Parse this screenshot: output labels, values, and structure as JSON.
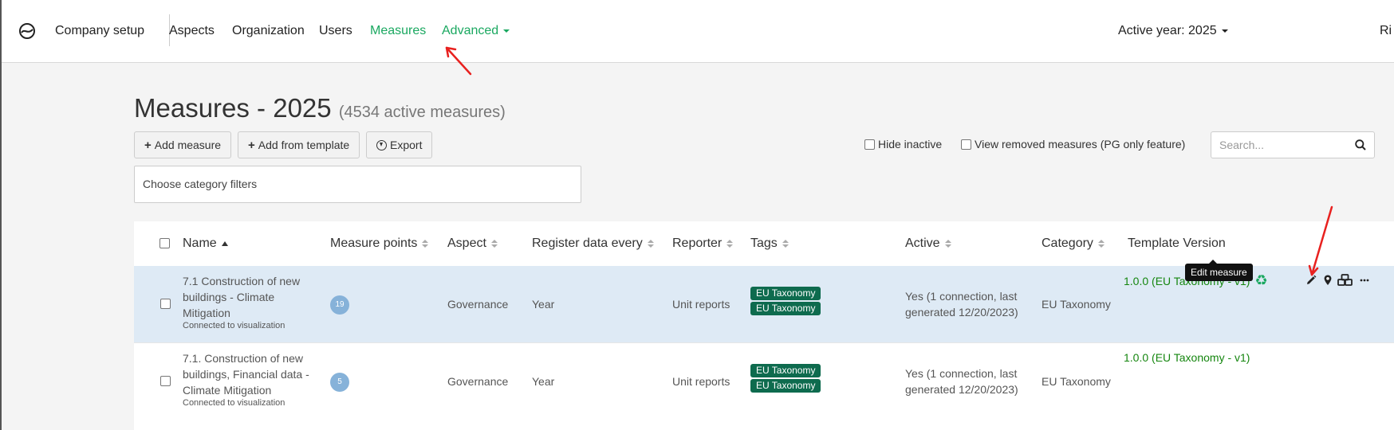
{
  "nav": {
    "brand": "Company setup",
    "items": [
      {
        "label": "Aspects"
      },
      {
        "label": "Organization"
      },
      {
        "label": "Users"
      },
      {
        "label": "Measures"
      },
      {
        "label": "Advanced"
      }
    ],
    "active_year": "Active year: 2025",
    "user_partial": "Ri"
  },
  "page": {
    "title": "Measures - 2025",
    "subtitle": "(4534 active measures)"
  },
  "toolbar": {
    "add_measure": "Add measure",
    "add_from_template": "Add from template",
    "export": "Export",
    "hide_inactive": "Hide inactive",
    "view_removed": "View removed measures (PG only feature)",
    "search_placeholder": "Search..."
  },
  "filter": {
    "placeholder": "Choose category filters"
  },
  "table": {
    "headers": {
      "name": "Name",
      "points": "Measure points",
      "aspect": "Aspect",
      "register": "Register data every",
      "reporter": "Reporter",
      "tags": "Tags",
      "active": "Active",
      "category": "Category",
      "template": "Template Version"
    },
    "rows": [
      {
        "name_l1": "7.1 Construction of new",
        "name_l2": "buildings - Climate",
        "name_l3": "Mitigation",
        "sub": "Connected to visualization",
        "points": "19",
        "aspect": "Governance",
        "register": "Year",
        "reporter": "Unit reports",
        "tag1": "EU Taxonomy",
        "tag2": "EU Taxonomy",
        "active_l1": "Yes (1 connection, last",
        "active_l2": "generated 12/20/2023)",
        "category": "EU Taxonomy",
        "template": "1.0.0 (EU Taxonomy - v1)"
      },
      {
        "name_l1": "7.1. Construction of new",
        "name_l2": "buildings, Financial data -",
        "name_l3": "Climate Mitigation",
        "sub": "Connected to visualization",
        "points": "5",
        "aspect": "Governance",
        "register": "Year",
        "reporter": "Unit reports",
        "tag1": "EU Taxonomy",
        "tag2": "EU Taxonomy",
        "active_l1": "Yes (1 connection, last",
        "active_l2": "generated 12/20/2023)",
        "category": "EU Taxonomy",
        "template": "1.0.0 (EU Taxonomy - v1)"
      }
    ]
  },
  "tooltip": "Edit measure",
  "colors": {
    "accent_green": "#1aa860",
    "tag_bg": "#0e6b4e",
    "row_highlight": "#deeaf5",
    "template_green": "#15860f",
    "annotation_red": "#e8211f"
  }
}
